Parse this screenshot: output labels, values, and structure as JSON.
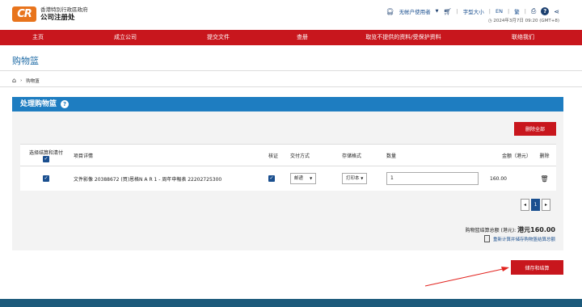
{
  "header": {
    "logo_text": "CR",
    "org_line1": "香港特別行政區政府",
    "org_line2": "公司注册处",
    "account_label": "无帐户使用者",
    "font_size_label": "字型大小",
    "lang_en": "EN",
    "lang_tc": "繁",
    "clock": "2024年3月7日 09:20 (GMT+8)"
  },
  "nav": {
    "items": [
      "主页",
      "成立公司",
      "提交文件",
      "查册",
      "取览不提供的资料/受保护资料",
      "联络我们"
    ]
  },
  "page_title": "购物篮",
  "breadcrumb": {
    "current": "购物篮"
  },
  "panel": {
    "title": "处理购物篮",
    "delete_all": "删除全部",
    "headers": {
      "select": "选择结算和清付",
      "detail": "项目详情",
      "cert": "核证",
      "delivery": "交付方式",
      "format": "存储格式",
      "quantity": "数量",
      "amount": "金额（港元）",
      "delete": "删除"
    },
    "row": {
      "detail": "文件影像 20388672 (買)恩格N A R 1 - 周年申報表 22202725300",
      "delivery": "邮递",
      "format": "打印本",
      "quantity": "1",
      "amount": "160.00"
    },
    "pager": {
      "prev": "◂",
      "page": "1",
      "next": "▸"
    },
    "total_label": "购物篮结算总额 (港元):",
    "total_value": "港元160.00",
    "recalc_label": "重新计算并储存购物篮结算总额"
  },
  "checkout_button": "储存和结算",
  "colors": {
    "brand_red": "#c8161d",
    "panel_blue": "#1e7dc1",
    "link_blue": "#1a4f8f",
    "logo_orange": "#e8741c"
  }
}
